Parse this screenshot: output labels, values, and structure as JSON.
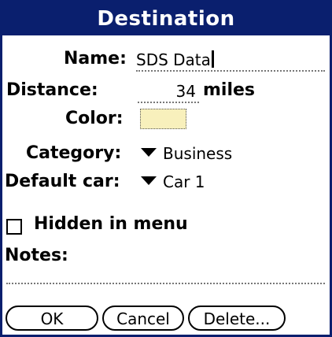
{
  "dialog": {
    "title": "Destination"
  },
  "fields": {
    "name_label": "Name:",
    "name_value": "SDS Data",
    "distance_label": "Distance:",
    "distance_value": "34",
    "distance_unit": "miles",
    "color_label": "Color:",
    "color_value": "#f8f0bc",
    "category_label": "Category:",
    "category_value": "Business",
    "default_car_label": "Default car:",
    "default_car_value": "Car 1",
    "hidden_label": "Hidden in menu",
    "hidden_checked": false,
    "notes_label": "Notes:",
    "notes_value": ""
  },
  "buttons": {
    "ok": "OK",
    "cancel": "Cancel",
    "delete": "Delete..."
  },
  "colors": {
    "title_bar": "#0a1f6e",
    "title_text": "#ffffff"
  },
  "icons": {
    "dropdown": "triangle-down-icon",
    "checkbox": "checkbox-unchecked-icon"
  }
}
